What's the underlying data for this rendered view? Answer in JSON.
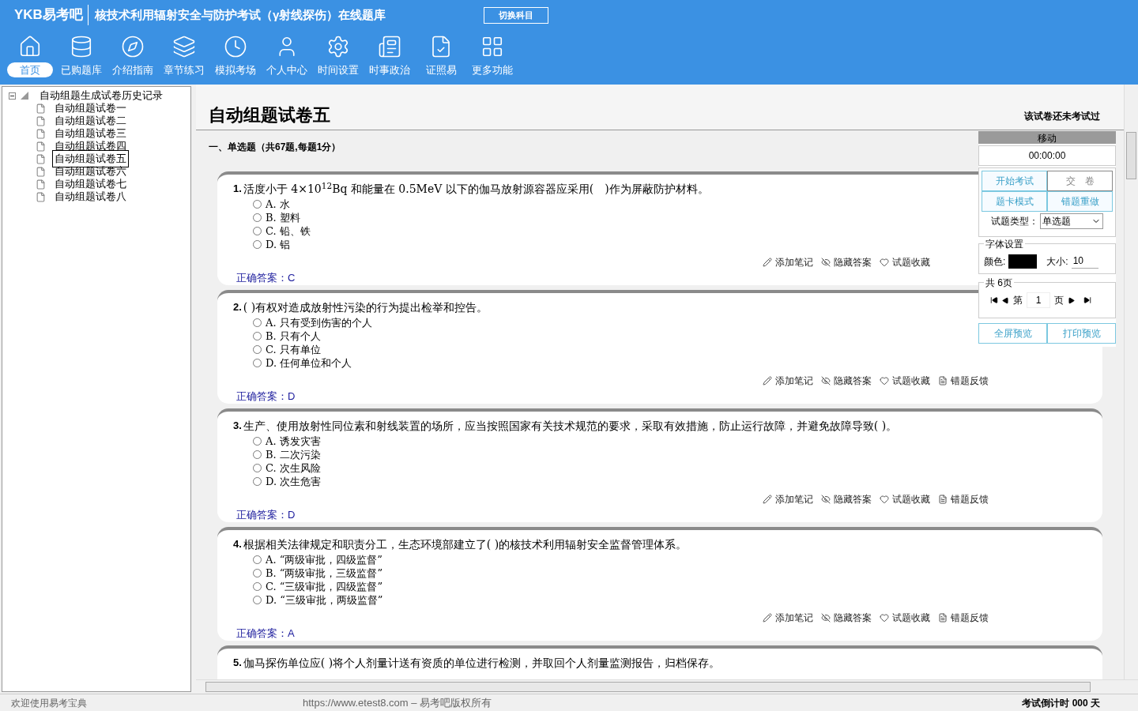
{
  "header": {
    "brand": "YKB易考吧",
    "title": "核技术利用辐射安全与防护考试（γ射线探伤）在线题库",
    "switch_button": "切换科目"
  },
  "nav": [
    {
      "label": "首页",
      "selected": true
    },
    {
      "label": "已购题库",
      "selected": false
    },
    {
      "label": "介绍指南",
      "selected": false
    },
    {
      "label": "章节练习",
      "selected": false
    },
    {
      "label": "模拟考场",
      "selected": false
    },
    {
      "label": "个人中心",
      "selected": false
    },
    {
      "label": "时间设置",
      "selected": false
    },
    {
      "label": "时事政治",
      "selected": false
    },
    {
      "label": "证照易",
      "selected": false
    },
    {
      "label": "更多功能",
      "selected": false
    }
  ],
  "tree": {
    "label": "自动组题生成试卷历史记录",
    "expanded": true,
    "children": [
      {
        "label": "自动组题试卷一",
        "selected": false
      },
      {
        "label": "自动组题试卷二",
        "selected": false
      },
      {
        "label": "自动组题试卷三",
        "selected": false
      },
      {
        "label": "自动组题试卷四",
        "selected": false
      },
      {
        "label": "自动组题试卷五",
        "selected": true
      },
      {
        "label": "自动组题试卷六",
        "selected": false
      },
      {
        "label": "自动组题试卷七",
        "selected": false
      },
      {
        "label": "自动组题试卷八",
        "selected": false
      }
    ]
  },
  "exam": {
    "title": "自动组题试卷五",
    "status": "该试卷还未考试过",
    "section": "一、单选题（共67题,每题1分）",
    "questions": [
      {
        "number": "1.",
        "text": "活度小于 4×10$^{12}$Bq 和能量在 0.5MeV 以下的伽马放射源容器应采用(　)作为屏蔽防护材料。",
        "options": [
          {
            "label": "A. 水",
            "selected": false
          },
          {
            "label": "B. 塑料",
            "selected": false
          },
          {
            "label": "C. 铅、铁",
            "selected": false
          },
          {
            "label": "D. 铝",
            "selected": false
          }
        ],
        "answer_label": "正确答案：",
        "answer": "C",
        "actions": [
          "添加笔记",
          "隐藏答案",
          "试题收藏"
        ]
      },
      {
        "number": "2.",
        "text": "( )有权对造成放射性污染的行为提出检举和控告。",
        "options": [
          {
            "label": "A. 只有受到伤害的个人",
            "selected": false
          },
          {
            "label": "B. 只有个人",
            "selected": false
          },
          {
            "label": "C. 只有单位",
            "selected": false
          },
          {
            "label": "D. 任何单位和个人",
            "selected": false
          }
        ],
        "answer_label": "正确答案：",
        "answer": "D",
        "actions": [
          "添加笔记",
          "隐藏答案",
          "试题收藏",
          "错题反馈"
        ]
      },
      {
        "number": "3.",
        "text": "生产、使用放射性同位素和射线装置的场所，应当按照国家有关技术规范的要求，采取有效措施，防止运行故障，并避免故障导致( )。",
        "options": [
          {
            "label": "A. 诱发灾害",
            "selected": false
          },
          {
            "label": "B. 二次污染",
            "selected": false
          },
          {
            "label": "C. 次生风险",
            "selected": false
          },
          {
            "label": "D. 次生危害",
            "selected": false
          }
        ],
        "answer_label": "正确答案：",
        "answer": "D",
        "actions": [
          "添加笔记",
          "隐藏答案",
          "试题收藏",
          "错题反馈"
        ]
      },
      {
        "number": "4.",
        "text": "根据相关法律规定和职责分工，生态环境部建立了( )的核技术利用辐射安全监督管理体系。",
        "options": [
          {
            "label": "A. “两级审批，四级监督”",
            "selected": false
          },
          {
            "label": "B. “两级审批，三级监督”",
            "selected": false
          },
          {
            "label": "C. “三级审批，四级监督”",
            "selected": false
          },
          {
            "label": "D. “三级审批，两级监督”",
            "selected": false
          }
        ],
        "answer_label": "正确答案：",
        "answer": "A",
        "actions": [
          "添加笔记",
          "隐藏答案",
          "试题收藏",
          "错题反馈"
        ]
      },
      {
        "number": "5.",
        "text": "伽马探伤单位应( )将个人剂量计送有资质的单位进行检测，并取回个人剂量监测报告，归档保存。"
      }
    ]
  },
  "panel": {
    "move": "移动",
    "timer": "00:00:00",
    "buttons": [
      {
        "label": "开始考试",
        "disabled": false
      },
      {
        "label": "交　卷",
        "disabled": true
      },
      {
        "label": "题卡模式",
        "disabled": false
      },
      {
        "label": "错题重做",
        "disabled": false
      }
    ],
    "type_label": "试题类型：",
    "type_value": "单选题",
    "font_settings": {
      "legend": "字体设置",
      "color_label": "颜色:",
      "color": "#000000",
      "size_label": "大小:",
      "size": "10"
    },
    "paging": {
      "legend": "共 6页",
      "prefix": "第",
      "page": "1",
      "suffix": "页"
    },
    "bottom_buttons": [
      "全屏预览",
      "打印预览"
    ]
  },
  "status_bar": {
    "welcome": "欢迎使用易考宝典",
    "copyright": "https://www.etest8.com – 易考吧版权所有",
    "countdown": "考试倒计时 000 天"
  }
}
